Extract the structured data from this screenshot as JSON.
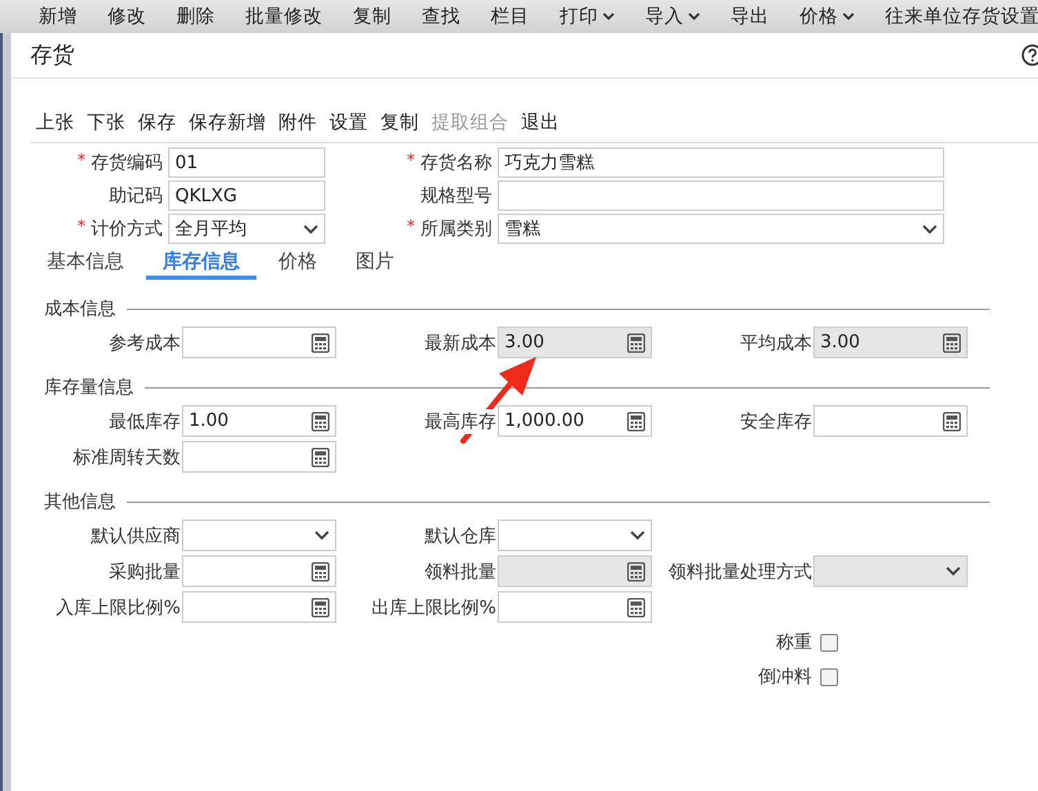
{
  "menu": [
    {
      "label": "新增",
      "dropdown": false
    },
    {
      "label": "修改",
      "dropdown": false
    },
    {
      "label": "删除",
      "dropdown": false
    },
    {
      "label": "批量修改",
      "dropdown": false
    },
    {
      "label": "复制",
      "dropdown": false
    },
    {
      "label": "查找",
      "dropdown": false
    },
    {
      "label": "栏目",
      "dropdown": false
    },
    {
      "label": "打印",
      "dropdown": true
    },
    {
      "label": "导入",
      "dropdown": true
    },
    {
      "label": "导出",
      "dropdown": false
    },
    {
      "label": "价格",
      "dropdown": true
    },
    {
      "label": "往来单位存货设置",
      "dropdown": false
    }
  ],
  "dialog": {
    "title": "存货"
  },
  "toolbar": [
    {
      "label": "上张",
      "disabled": false
    },
    {
      "label": "下张",
      "disabled": false
    },
    {
      "label": "保存",
      "disabled": false
    },
    {
      "label": "保存新增",
      "disabled": false
    },
    {
      "label": "附件",
      "disabled": false
    },
    {
      "label": "设置",
      "disabled": false
    },
    {
      "label": "复制",
      "disabled": false
    },
    {
      "label": "提取组合",
      "disabled": true
    },
    {
      "label": "退出",
      "disabled": false
    }
  ],
  "header_fields": [
    [
      {
        "required_mark": "*",
        "label": "存货编码",
        "kind": "text",
        "value": "01"
      },
      {
        "required_mark": "*",
        "label": "存货名称",
        "kind": "text",
        "value": "巧克力雪糕"
      }
    ],
    [
      {
        "label": "助记码",
        "kind": "text",
        "value": "QKLXG"
      },
      {
        "label": "规格型号",
        "kind": "text"
      }
    ],
    [
      {
        "required_mark": "*",
        "label": "计价方式",
        "kind": "select",
        "value": "全月平均"
      },
      {
        "required_mark": "*",
        "label": "所属类别",
        "kind": "select",
        "value": "雪糕"
      }
    ]
  ],
  "tabs": [
    {
      "label": "基本信息",
      "selected": false
    },
    {
      "label": "库存信息",
      "selected": true
    },
    {
      "label": "价格",
      "selected": false
    },
    {
      "label": "图片",
      "selected": false
    }
  ],
  "sections": [
    {
      "title": "成本信息",
      "rows": [
        [
          {
            "label": "参考成本",
            "kind": "calc",
            "disabled": false
          },
          {
            "label": "最新成本",
            "kind": "calc",
            "value": "3.00",
            "disabled": true
          },
          {
            "label": "平均成本",
            "kind": "calc",
            "value": "3.00",
            "disabled": true
          }
        ]
      ]
    },
    {
      "title": "库存量信息",
      "rows": [
        [
          {
            "label": "最低库存",
            "kind": "calc",
            "value": "1.00",
            "disabled": false
          },
          {
            "label": "最高库存",
            "kind": "calc",
            "value": "1,000.00",
            "disabled": false
          },
          {
            "label": "安全库存",
            "kind": "calc",
            "disabled": false
          }
        ],
        [
          {
            "label": "标准周转天数",
            "kind": "calc",
            "disabled": false
          },
          null,
          null
        ]
      ]
    },
    {
      "title": "其他信息",
      "rows": [
        [
          {
            "label": "默认供应商",
            "kind": "select",
            "disabled": false
          },
          {
            "label": "默认仓库",
            "kind": "select",
            "disabled": false
          },
          null
        ],
        [
          {
            "label": "采购批量",
            "kind": "calc",
            "disabled": false
          },
          {
            "label": "领料批量",
            "kind": "calc",
            "disabled": true
          },
          {
            "label": "领料批量处理方式",
            "kind": "select",
            "disabled": true
          }
        ],
        [
          {
            "label": "入库上限比例%",
            "kind": "calc",
            "disabled": false
          },
          {
            "label": "出库上限比例%",
            "kind": "calc",
            "disabled": false
          },
          null
        ],
        [
          null,
          null,
          {
            "label": "称重",
            "kind": "checkbox",
            "checked": false
          }
        ],
        [
          null,
          null,
          {
            "label": "倒冲料",
            "kind": "checkbox",
            "checked": false
          }
        ]
      ]
    }
  ]
}
